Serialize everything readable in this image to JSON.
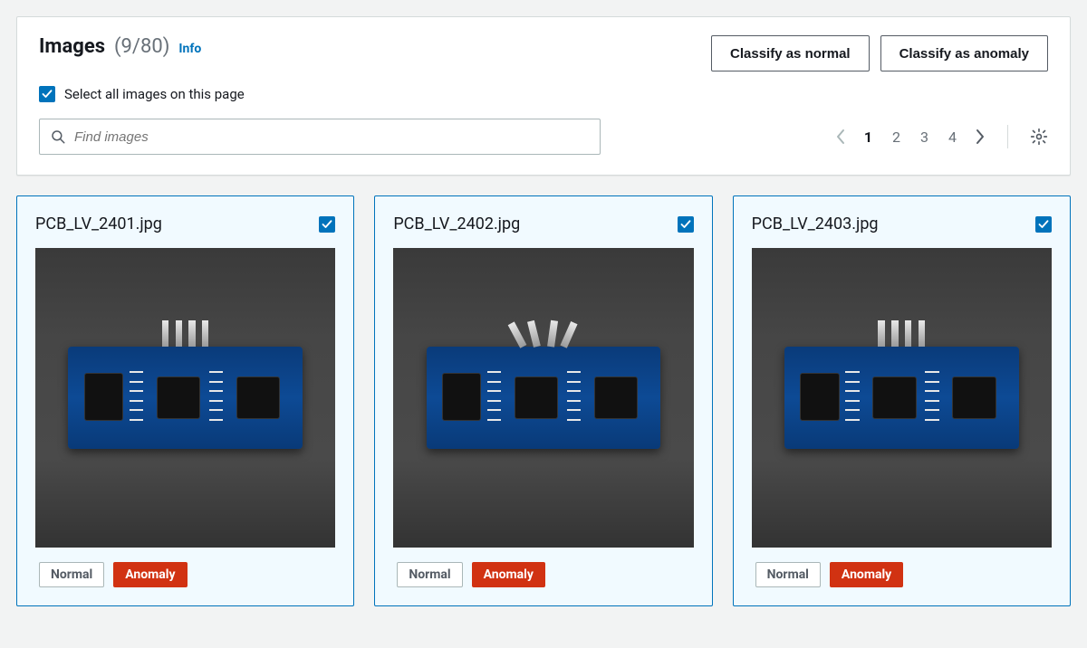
{
  "header": {
    "title": "Images",
    "count_display": "(9/80)",
    "info_label": "Info",
    "classify_normal_label": "Classify as normal",
    "classify_anomaly_label": "Classify as anomaly",
    "select_all_label": "Select all images on this page",
    "select_all_checked": true
  },
  "search": {
    "placeholder": "Find images"
  },
  "pagination": {
    "pages": [
      "1",
      "2",
      "3",
      "4"
    ],
    "current": "1",
    "has_prev": false,
    "has_next": true
  },
  "tags": {
    "normal": "Normal",
    "anomaly": "Anomaly"
  },
  "cards": [
    {
      "filename": "PCB_LV_2401.jpg",
      "selected": true,
      "pins_variant": "upright"
    },
    {
      "filename": "PCB_LV_2402.jpg",
      "selected": true,
      "pins_variant": "bent"
    },
    {
      "filename": "PCB_LV_2403.jpg",
      "selected": true,
      "pins_variant": "upright"
    }
  ]
}
